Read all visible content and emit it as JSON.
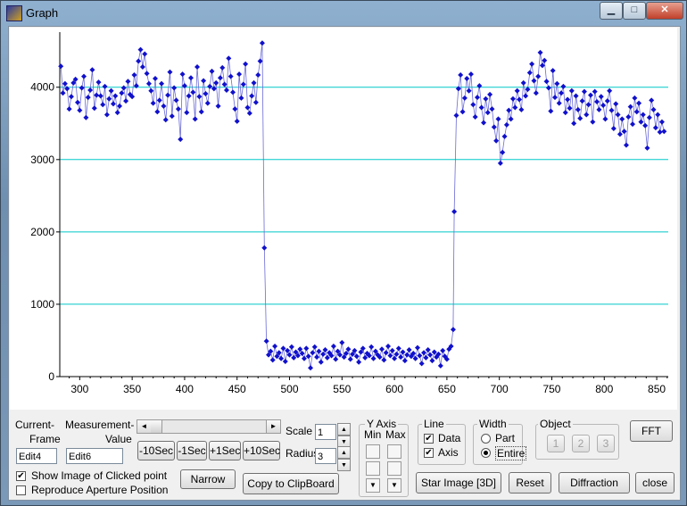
{
  "window": {
    "title": "Graph",
    "minimize": "▁",
    "maximize": "□",
    "close": "✕"
  },
  "colors": {
    "data": "#1010cc",
    "grid": "#00c8c8",
    "axis": "#000000"
  },
  "chart_data": {
    "type": "scatter",
    "title": "",
    "xlabel": "",
    "ylabel": "",
    "xlim": [
      281,
      861
    ],
    "ylim": [
      0,
      4700
    ],
    "xticks": [
      "300",
      "350",
      "400",
      "450",
      "500",
      "550",
      "600",
      "650",
      "700",
      "750",
      "800",
      "850"
    ],
    "yticks": [
      "0",
      "1000",
      "2000",
      "3000",
      "4000"
    ],
    "grid": true,
    "line": true,
    "note_segments": [
      {
        "x_from": 282,
        "x_to": 475,
        "level": 3950,
        "spread": 250
      },
      {
        "x_from": 476,
        "x_to": 476,
        "level": 1780,
        "spread": 0
      },
      {
        "x_from": 477,
        "x_to": 656,
        "level": 290,
        "spread": 120
      },
      {
        "x_from": 657,
        "x_to": 657,
        "level": 2280,
        "spread": 0
      },
      {
        "x_from": 658,
        "x_to": 858,
        "level": 3780,
        "spread": 280
      }
    ],
    "series": [
      {
        "values": [
          [
            282,
            4290
          ],
          [
            284,
            3920
          ],
          [
            286,
            4050
          ],
          [
            288,
            3980
          ],
          [
            290,
            3700
          ],
          [
            292,
            3870
          ],
          [
            294,
            4060
          ],
          [
            296,
            4110
          ],
          [
            298,
            3790
          ],
          [
            300,
            3680
          ],
          [
            302,
            3990
          ],
          [
            304,
            4150
          ],
          [
            306,
            3580
          ],
          [
            308,
            3860
          ],
          [
            310,
            3960
          ],
          [
            312,
            4240
          ],
          [
            314,
            3710
          ],
          [
            316,
            3890
          ],
          [
            318,
            4070
          ],
          [
            320,
            3880
          ],
          [
            322,
            3760
          ],
          [
            324,
            4010
          ],
          [
            326,
            3620
          ],
          [
            328,
            3840
          ],
          [
            330,
            3950
          ],
          [
            332,
            3770
          ],
          [
            334,
            3880
          ],
          [
            336,
            3650
          ],
          [
            338,
            3740
          ],
          [
            340,
            3920
          ],
          [
            342,
            3990
          ],
          [
            344,
            3810
          ],
          [
            346,
            4080
          ],
          [
            348,
            3900
          ],
          [
            350,
            3870
          ],
          [
            352,
            4170
          ],
          [
            354,
            4020
          ],
          [
            356,
            4360
          ],
          [
            358,
            4520
          ],
          [
            360,
            4280
          ],
          [
            362,
            4460
          ],
          [
            364,
            4190
          ],
          [
            366,
            4050
          ],
          [
            368,
            3950
          ],
          [
            370,
            3780
          ],
          [
            372,
            4120
          ],
          [
            374,
            3660
          ],
          [
            376,
            3820
          ],
          [
            378,
            4050
          ],
          [
            380,
            3740
          ],
          [
            382,
            3550
          ],
          [
            384,
            3890
          ],
          [
            386,
            4210
          ],
          [
            388,
            3600
          ],
          [
            390,
            3990
          ],
          [
            392,
            3820
          ],
          [
            394,
            3700
          ],
          [
            396,
            3280
          ],
          [
            398,
            4180
          ],
          [
            400,
            4020
          ],
          [
            402,
            3650
          ],
          [
            404,
            3880
          ],
          [
            406,
            4130
          ],
          [
            408,
            3930
          ],
          [
            410,
            3560
          ],
          [
            412,
            4280
          ],
          [
            414,
            3870
          ],
          [
            416,
            3660
          ],
          [
            418,
            4090
          ],
          [
            420,
            3910
          ],
          [
            422,
            3780
          ],
          [
            424,
            4010
          ],
          [
            426,
            4220
          ],
          [
            428,
            3980
          ],
          [
            430,
            4060
          ],
          [
            432,
            3740
          ],
          [
            434,
            4130
          ],
          [
            436,
            4270
          ],
          [
            438,
            4040
          ],
          [
            440,
            3960
          ],
          [
            442,
            4400
          ],
          [
            444,
            4150
          ],
          [
            446,
            3930
          ],
          [
            448,
            3700
          ],
          [
            450,
            3530
          ],
          [
            452,
            4180
          ],
          [
            454,
            3850
          ],
          [
            456,
            4040
          ],
          [
            458,
            4320
          ],
          [
            460,
            3720
          ],
          [
            462,
            3640
          ],
          [
            464,
            3880
          ],
          [
            466,
            4060
          ],
          [
            468,
            3790
          ],
          [
            470,
            4170
          ],
          [
            472,
            4360
          ],
          [
            474,
            4610
          ],
          [
            476,
            1780
          ],
          [
            478,
            490
          ],
          [
            480,
            300
          ],
          [
            482,
            350
          ],
          [
            484,
            230
          ],
          [
            486,
            420
          ],
          [
            488,
            280
          ],
          [
            490,
            330
          ],
          [
            492,
            250
          ],
          [
            494,
            390
          ],
          [
            496,
            210
          ],
          [
            498,
            360
          ],
          [
            500,
            300
          ],
          [
            502,
            410
          ],
          [
            504,
            260
          ],
          [
            506,
            340
          ],
          [
            508,
            290
          ],
          [
            510,
            380
          ],
          [
            512,
            320
          ],
          [
            514,
            250
          ],
          [
            516,
            390
          ],
          [
            518,
            280
          ],
          [
            520,
            120
          ],
          [
            522,
            330
          ],
          [
            524,
            410
          ],
          [
            526,
            270
          ],
          [
            528,
            350
          ],
          [
            530,
            200
          ],
          [
            532,
            310
          ],
          [
            534,
            370
          ],
          [
            536,
            260
          ],
          [
            538,
            330
          ],
          [
            540,
            290
          ],
          [
            542,
            420
          ],
          [
            544,
            240
          ],
          [
            546,
            350
          ],
          [
            548,
            300
          ],
          [
            550,
            470
          ],
          [
            552,
            270
          ],
          [
            554,
            320
          ],
          [
            556,
            380
          ],
          [
            558,
            240
          ],
          [
            560,
            310
          ],
          [
            562,
            360
          ],
          [
            564,
            280
          ],
          [
            566,
            200
          ],
          [
            568,
            340
          ],
          [
            570,
            390
          ],
          [
            572,
            260
          ],
          [
            574,
            320
          ],
          [
            576,
            290
          ],
          [
            578,
            410
          ],
          [
            580,
            250
          ],
          [
            582,
            350
          ],
          [
            584,
            300
          ],
          [
            586,
            270
          ],
          [
            588,
            380
          ],
          [
            590,
            230
          ],
          [
            592,
            330
          ],
          [
            594,
            420
          ],
          [
            596,
            290
          ],
          [
            598,
            360
          ],
          [
            600,
            250
          ],
          [
            602,
            310
          ],
          [
            604,
            390
          ],
          [
            606,
            270
          ],
          [
            608,
            340
          ],
          [
            610,
            220
          ],
          [
            612,
            300
          ],
          [
            614,
            370
          ],
          [
            616,
            280
          ],
          [
            618,
            320
          ],
          [
            620,
            250
          ],
          [
            622,
            400
          ],
          [
            624,
            290
          ],
          [
            626,
            180
          ],
          [
            628,
            330
          ],
          [
            630,
            260
          ],
          [
            632,
            370
          ],
          [
            634,
            300
          ],
          [
            636,
            220
          ],
          [
            638,
            340
          ],
          [
            640,
            270
          ],
          [
            642,
            310
          ],
          [
            644,
            150
          ],
          [
            646,
            360
          ],
          [
            648,
            280
          ],
          [
            650,
            240
          ],
          [
            652,
            380
          ],
          [
            654,
            420
          ],
          [
            656,
            650
          ],
          [
            657,
            2280
          ],
          [
            659,
            3610
          ],
          [
            661,
            3980
          ],
          [
            663,
            4170
          ],
          [
            665,
            3660
          ],
          [
            667,
            3850
          ],
          [
            669,
            4120
          ],
          [
            671,
            3950
          ],
          [
            673,
            4180
          ],
          [
            675,
            3760
          ],
          [
            677,
            3590
          ],
          [
            679,
            3860
          ],
          [
            681,
            4020
          ],
          [
            683,
            3720
          ],
          [
            685,
            3510
          ],
          [
            687,
            3840
          ],
          [
            689,
            3650
          ],
          [
            691,
            3900
          ],
          [
            693,
            3700
          ],
          [
            695,
            3450
          ],
          [
            697,
            3260
          ],
          [
            699,
            3560
          ],
          [
            701,
            2950
          ],
          [
            703,
            3100
          ],
          [
            705,
            3320
          ],
          [
            707,
            3480
          ],
          [
            709,
            3680
          ],
          [
            711,
            3560
          ],
          [
            713,
            3840
          ],
          [
            715,
            3720
          ],
          [
            717,
            3950
          ],
          [
            719,
            3830
          ],
          [
            721,
            3690
          ],
          [
            723,
            4060
          ],
          [
            725,
            3880
          ],
          [
            727,
            3970
          ],
          [
            729,
            4200
          ],
          [
            731,
            4320
          ],
          [
            733,
            4090
          ],
          [
            735,
            3920
          ],
          [
            737,
            4150
          ],
          [
            739,
            4480
          ],
          [
            741,
            4300
          ],
          [
            743,
            4370
          ],
          [
            745,
            4080
          ],
          [
            747,
            3990
          ],
          [
            749,
            3670
          ],
          [
            751,
            4230
          ],
          [
            753,
            3860
          ],
          [
            755,
            4050
          ],
          [
            757,
            3780
          ],
          [
            759,
            3920
          ],
          [
            761,
            4010
          ],
          [
            763,
            3650
          ],
          [
            765,
            3830
          ],
          [
            767,
            3710
          ],
          [
            769,
            3950
          ],
          [
            771,
            3500
          ],
          [
            773,
            3880
          ],
          [
            775,
            3690
          ],
          [
            777,
            3570
          ],
          [
            779,
            3810
          ],
          [
            781,
            3940
          ],
          [
            783,
            3620
          ],
          [
            785,
            3760
          ],
          [
            787,
            3890
          ],
          [
            789,
            3520
          ],
          [
            791,
            3940
          ],
          [
            793,
            3800
          ],
          [
            795,
            3690
          ],
          [
            797,
            3870
          ],
          [
            799,
            3750
          ],
          [
            801,
            3560
          ],
          [
            803,
            3810
          ],
          [
            805,
            3950
          ],
          [
            807,
            3680
          ],
          [
            809,
            3430
          ],
          [
            811,
            3770
          ],
          [
            813,
            3620
          ],
          [
            815,
            3350
          ],
          [
            817,
            3560
          ],
          [
            819,
            3390
          ],
          [
            821,
            3200
          ],
          [
            823,
            3590
          ],
          [
            825,
            3730
          ],
          [
            827,
            3490
          ],
          [
            829,
            3850
          ],
          [
            831,
            3660
          ],
          [
            833,
            3780
          ],
          [
            835,
            3520
          ],
          [
            837,
            3620
          ],
          [
            839,
            3470
          ],
          [
            841,
            3160
          ],
          [
            843,
            3580
          ],
          [
            845,
            3820
          ],
          [
            847,
            3690
          ],
          [
            849,
            3440
          ],
          [
            851,
            3620
          ],
          [
            853,
            3380
          ],
          [
            855,
            3520
          ],
          [
            857,
            3390
          ]
        ]
      }
    ]
  },
  "controls": {
    "current_frame_label_1": "Current-",
    "current_frame_label_2": "Frame",
    "measurement_value_label_1": "Measurement-",
    "measurement_value_label_2": "Value",
    "edit4": "Edit4",
    "edit6": "Edit6",
    "minus10": "-10Sec",
    "minus1": "-1Sec",
    "plus1": "+1Sec",
    "plus10": "+10Sec",
    "scale_label": "Scale",
    "scale_value": "1",
    "radius_label": "Radius",
    "radius_value": "3",
    "yaxis_title": "Y Axis",
    "y_min": "Min",
    "y_max": "Max",
    "line_title": "Line",
    "data_check": "Data",
    "axis_check": "Axis",
    "width_title": "Width",
    "part_radio": "Part",
    "entire_radio": "Entire",
    "object_title": "Object",
    "object_1": "1",
    "object_2": "2",
    "object_3": "3",
    "fft": "FFT",
    "show_image": "Show Image of Clicked point",
    "reproduce": "Reproduce Aperture Position",
    "narrow": "Narrow",
    "copy": "Copy to ClipBoard",
    "star_image": "Star Image [3D]",
    "reset": "Reset",
    "diffraction": "Diffraction",
    "close": "close",
    "check_mark": "✔",
    "arrow_left": "◄",
    "arrow_right": "►",
    "arrow_up": "▲",
    "arrow_down": "▼"
  }
}
